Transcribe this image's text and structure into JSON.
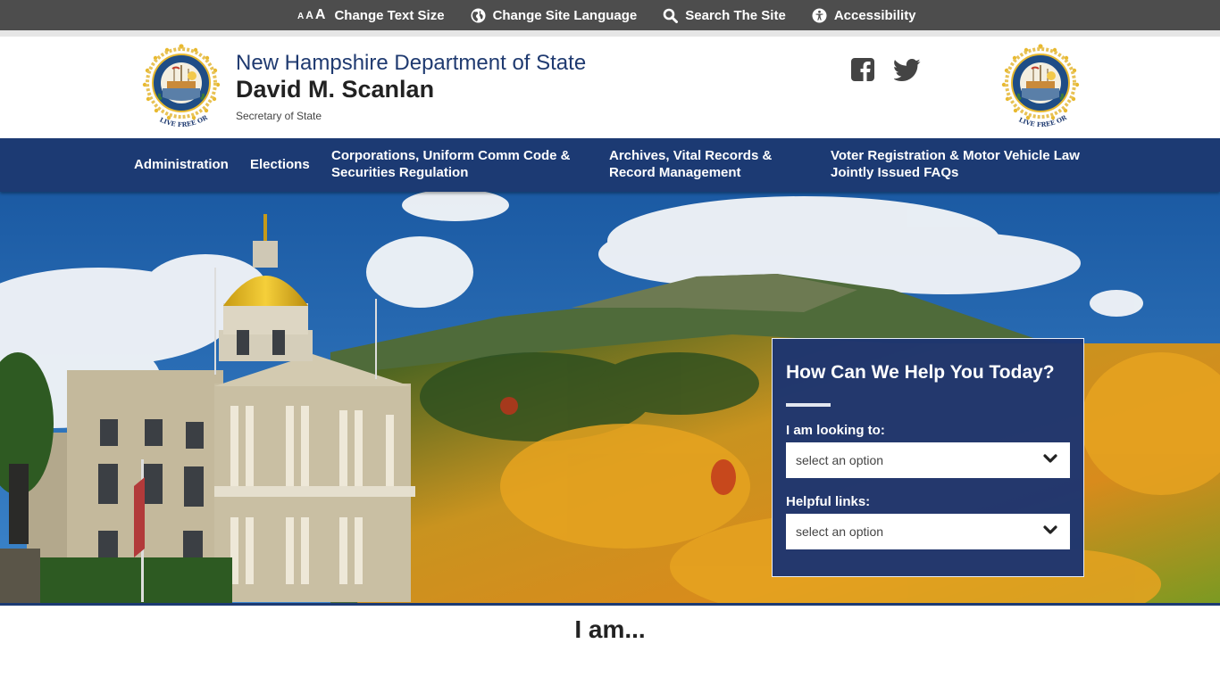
{
  "utility_bar": {
    "text_size": {
      "glyphs": [
        "A",
        "A",
        "A"
      ],
      "label": "Change Text Size",
      "icon": "text-size-icon"
    },
    "language": {
      "label": "Change Site Language",
      "icon": "globe-icon"
    },
    "search": {
      "label": "Search The Site",
      "icon": "search-icon"
    },
    "accessibility": {
      "label": "Accessibility",
      "icon": "accessibility-icon"
    }
  },
  "header": {
    "department": "New Hampshire Department of State",
    "name": "David M. Scanlan",
    "role": "Secretary of State",
    "seal_motto": "LIVE FREE OR DIE",
    "social": [
      {
        "name": "Facebook",
        "icon": "facebook-icon"
      },
      {
        "name": "Twitter",
        "icon": "twitter-icon"
      }
    ]
  },
  "nav": {
    "items": [
      {
        "line1": "Administration",
        "line2": ""
      },
      {
        "line1": "Elections",
        "line2": ""
      },
      {
        "line1": "Corporations, Uniform Comm Code &",
        "line2": "Securities Regulation"
      },
      {
        "line1": "Archives, Vital Records &",
        "line2": "Record Management"
      },
      {
        "line1": "Voter Registration & Motor Vehicle Law",
        "line2": "Jointly Issued FAQs"
      }
    ]
  },
  "help_box": {
    "title": "How Can We Help You Today?",
    "looking_label": "I am looking to:",
    "looking_value": "select an option",
    "links_label": "Helpful links:",
    "links_value": "select an option"
  },
  "section": {
    "heading": "I am..."
  },
  "colors": {
    "utility_bg": "#4d4d4d",
    "nav_bg": "#1c3a73",
    "dept_title": "#1f3a70",
    "seal_gold": "#e8b92f"
  }
}
